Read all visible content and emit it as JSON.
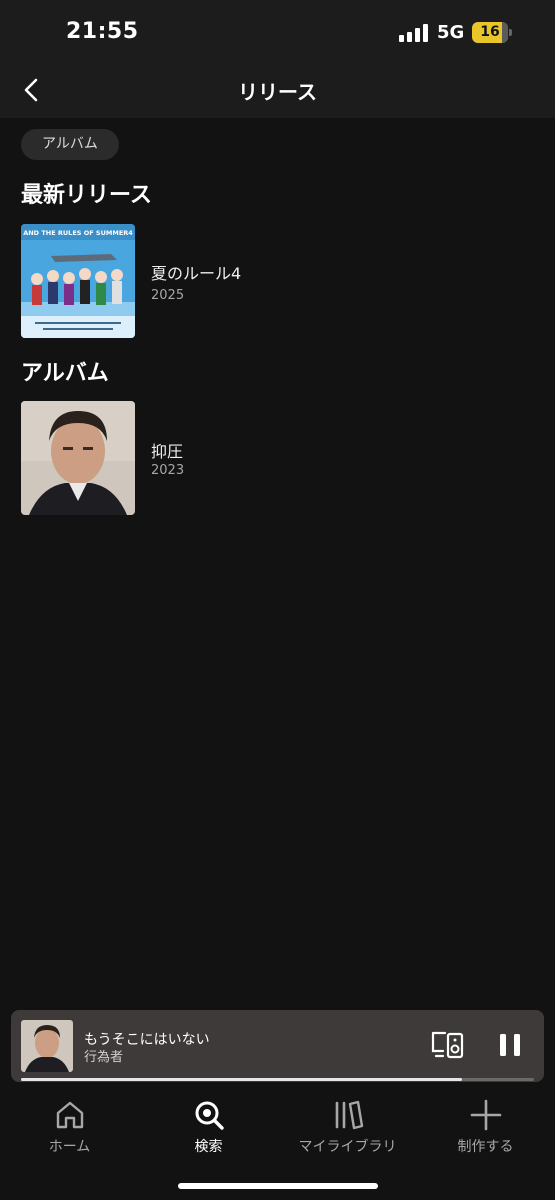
{
  "status_bar": {
    "time": "21:55",
    "network": "5G",
    "battery_level": "16"
  },
  "header": {
    "title": "リリース"
  },
  "filter_chip": {
    "label": "アルバム"
  },
  "sections": {
    "latest": {
      "title": "最新リリース",
      "item": {
        "name": "夏のルール4",
        "year": "2025",
        "cover_text": "AND THE RULES OF SUMMER4"
      }
    },
    "albums": {
      "title": "アルバム",
      "item": {
        "name": "抑圧",
        "year": "2023"
      }
    }
  },
  "mini_player": {
    "title": "もうそこにはいない",
    "artist": "行為者",
    "progress": 0.86
  },
  "nav": {
    "items": [
      {
        "label": "ホーム",
        "icon": "home-icon"
      },
      {
        "label": "検索",
        "icon": "search-icon"
      },
      {
        "label": "マイライブラリ",
        "icon": "library-icon"
      },
      {
        "label": "制作する",
        "icon": "plus-icon"
      }
    ],
    "active": "検索"
  },
  "colors": {
    "background": "#121212",
    "header": "#1c1c1c",
    "player": "#3d3a39",
    "battery": "#e8c52a"
  }
}
